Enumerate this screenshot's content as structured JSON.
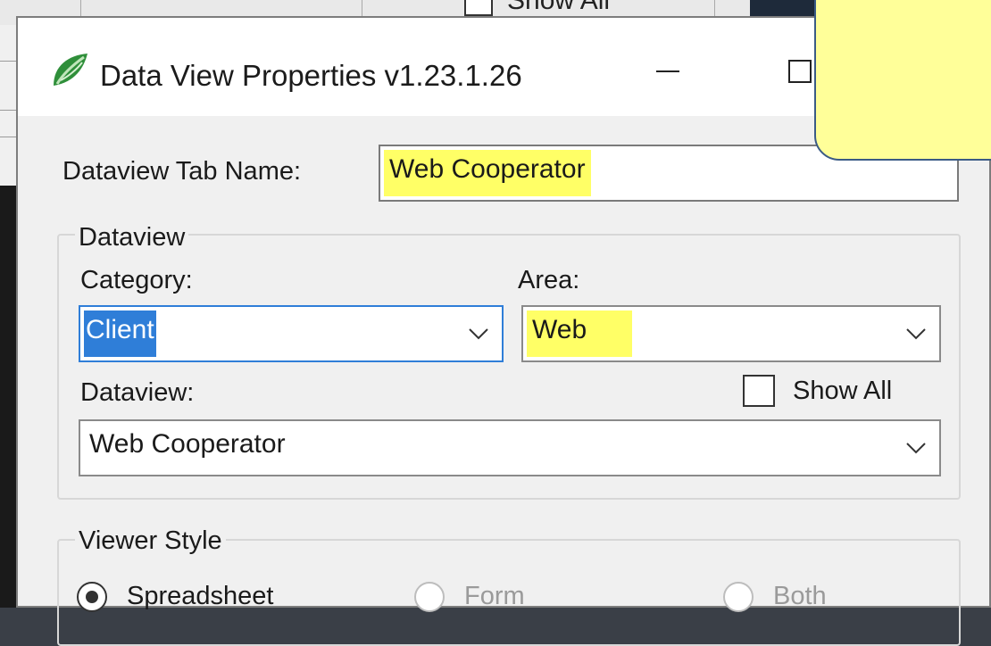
{
  "background": {
    "clipped_label": "Show All"
  },
  "dialog": {
    "title": "Data View Properties v1.23.1.26",
    "tab_name": {
      "label": "Dataview Tab Name:",
      "value": "Web Cooperator",
      "highlight_color": "#ffff66"
    },
    "dataview_group": {
      "legend": "Dataview",
      "category": {
        "label": "Category:",
        "value": "Client",
        "selection_color": "#2f7ed8"
      },
      "area": {
        "label": "Area:",
        "value": "Web",
        "highlight_color": "#ffff66"
      },
      "dataview": {
        "label": "Dataview:",
        "value": "Web Cooperator"
      },
      "show_all": {
        "label": "Show All",
        "checked": false
      }
    },
    "viewer_style_group": {
      "legend": "Viewer Style",
      "options": [
        {
          "label": "Spreadsheet",
          "checked": true,
          "enabled": true
        },
        {
          "label": "Form",
          "checked": false,
          "enabled": false
        },
        {
          "label": "Both",
          "checked": false,
          "enabled": false
        }
      ]
    }
  },
  "callout": {
    "fill": "#ffff99",
    "border": "#3b5b85"
  }
}
